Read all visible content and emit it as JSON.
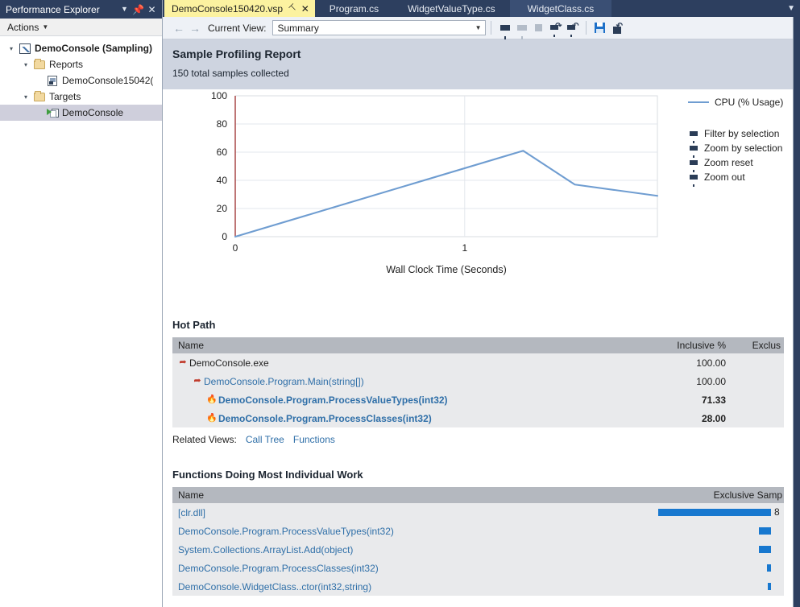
{
  "left_panel": {
    "title": "Performance Explorer",
    "window_buttons": [
      "chevron-down",
      "pin",
      "close"
    ],
    "actions_label": "Actions",
    "tree": [
      {
        "label": "DemoConsole (Sampling)",
        "icon": "sampling-chart-icon",
        "indent": 0,
        "expander": "expanded",
        "bold": true,
        "selected": false
      },
      {
        "label": "Reports",
        "icon": "folder-icon",
        "indent": 1,
        "expander": "expanded",
        "bold": false,
        "selected": false
      },
      {
        "label": "DemoConsole15042(",
        "icon": "report-icon",
        "indent": 2,
        "expander": "none",
        "bold": false,
        "selected": false
      },
      {
        "label": "Targets",
        "icon": "folder-icon",
        "indent": 1,
        "expander": "expanded",
        "bold": false,
        "selected": false
      },
      {
        "label": "DemoConsole",
        "icon": "target-icon",
        "indent": 2,
        "expander": "none",
        "bold": false,
        "selected": true
      }
    ]
  },
  "tabs": [
    {
      "label": "DemoConsole150420.vsp",
      "active": true,
      "has_pin": true,
      "has_close": true
    },
    {
      "label": "Program.cs",
      "active": false,
      "has_pin": false,
      "has_close": false
    },
    {
      "label": "WidgetValueType.cs",
      "active": false,
      "has_pin": false,
      "has_close": false
    },
    {
      "label": "WidgetClass.cs",
      "active": false,
      "has_pin": false,
      "has_close": false,
      "hovered": true
    }
  ],
  "toolbar": {
    "back_icon": "back-arrow-icon",
    "forward_icon": "forward-arrow-icon",
    "current_view_label": "Current View:",
    "view_value": "Summary",
    "view_options": [
      "Summary"
    ],
    "buttons": [
      {
        "name": "filter-button",
        "icon": "funnel-icon",
        "enabled": true
      },
      {
        "name": "clear-filter-button",
        "icon": "funnel-dim-icon",
        "enabled": false
      },
      {
        "name": "stop-button",
        "icon": "stop-square-icon",
        "enabled": false
      },
      {
        "name": "apply-filter-button",
        "icon": "funnel-apply-icon",
        "enabled": true
      },
      {
        "name": "reset-filter-button",
        "icon": "funnel-reset-icon",
        "enabled": true
      },
      {
        "name": "save-analysis-button",
        "icon": "floppy-save-icon",
        "enabled": true
      },
      {
        "name": "export-report-button",
        "icon": "export-icon",
        "enabled": true
      }
    ]
  },
  "report": {
    "title": "Sample Profiling Report",
    "subtitle": "150 total samples collected"
  },
  "chart_data": {
    "type": "line",
    "title": "",
    "xlabel": "Wall Clock Time (Seconds)",
    "ylabel": "",
    "xlim": [
      0,
      1.84
    ],
    "ylim": [
      0,
      100
    ],
    "xticks": [
      0,
      1
    ],
    "xticklabels": [
      "0",
      "1"
    ],
    "yticks": [
      0,
      20,
      40,
      60,
      80,
      100
    ],
    "yticklabels": [
      "0",
      "20",
      "40",
      "60",
      "80",
      "100"
    ],
    "grid": true,
    "legend_position": "right",
    "series": [
      {
        "name": "CPU (% Usage)",
        "color": "#6f9dd1",
        "x": [
          0.0,
          1.255,
          1.48,
          1.84
        ],
        "y": [
          0.0,
          61.0,
          37.0,
          29.0
        ]
      }
    ]
  },
  "legend": {
    "series_label": "CPU (% Usage)",
    "actions": [
      {
        "label": "Filter by selection",
        "icon": "funnel-icon"
      },
      {
        "label": "Zoom by selection",
        "icon": "funnel-icon"
      },
      {
        "label": "Zoom reset",
        "icon": "funnel-icon"
      },
      {
        "label": "Zoom out",
        "icon": "funnel-icon"
      }
    ]
  },
  "hot_path": {
    "title": "Hot Path",
    "columns": [
      "Name",
      "Inclusive %",
      "Exclus"
    ],
    "rows": [
      {
        "name": "DemoConsole.exe",
        "indent": 0,
        "icon": "hotpath-arrow-icon",
        "link": false,
        "bold": false,
        "inclusive": "100.00",
        "value_bold": false
      },
      {
        "name": "DemoConsole.Program.Main(string[])",
        "indent": 1,
        "icon": "hotpath-arrow-icon",
        "link": true,
        "bold": false,
        "inclusive": "100.00",
        "value_bold": false
      },
      {
        "name": "DemoConsole.Program.ProcessValueTypes(int32)",
        "indent": 2,
        "icon": "flame-icon",
        "link": true,
        "bold": true,
        "inclusive": "71.33",
        "value_bold": true
      },
      {
        "name": "DemoConsole.Program.ProcessClasses(int32)",
        "indent": 2,
        "icon": "flame-icon",
        "link": true,
        "bold": true,
        "inclusive": "28.00",
        "value_bold": true
      }
    ],
    "related_views_label": "Related Views:",
    "related_views": [
      "Call Tree",
      "Functions"
    ]
  },
  "functions_work": {
    "title": "Functions Doing Most Individual Work",
    "columns": [
      "Name",
      "Exclusive Samp"
    ],
    "rows": [
      {
        "name": "[clr.dll]",
        "bar_pct": 100,
        "value": "8"
      },
      {
        "name": "DemoConsole.Program.ProcessValueTypes(int32)",
        "bar_pct": 11,
        "value": ""
      },
      {
        "name": "System.Collections.ArrayList.Add(object)",
        "bar_pct": 11,
        "value": ""
      },
      {
        "name": "DemoConsole.Program.ProcessClasses(int32)",
        "bar_pct": 3,
        "value": ""
      },
      {
        "name": "DemoConsole.WidgetClass..ctor(int32,string)",
        "bar_pct": 2,
        "value": ""
      }
    ]
  },
  "colors": {
    "chrome": "#2d3f5f",
    "active_tab": "#fcf2a0",
    "accent_link": "#2f6fa8",
    "bar": "#1878cf",
    "series": "#6f9dd1",
    "header_band": "#ced4e0",
    "grid_header": "#b4b8bf"
  }
}
